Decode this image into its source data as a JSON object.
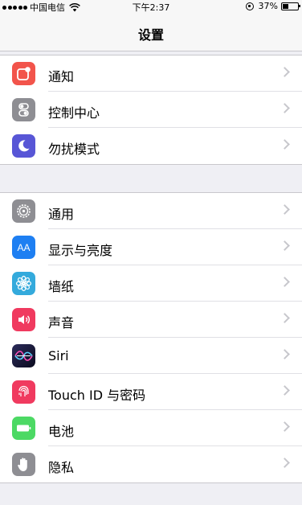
{
  "status_bar": {
    "carrier": "中国电信",
    "time": "下午2:37",
    "battery": "37%",
    "battery_level": 0.37
  },
  "nav": {
    "title": "设置"
  },
  "groups": [
    {
      "items": [
        {
          "label": "通知",
          "icon": "notifications-icon",
          "color": "#f2544b"
        },
        {
          "label": "控制中心",
          "icon": "control-center-icon",
          "color": "#8e8e93"
        },
        {
          "label": "勿扰模式",
          "icon": "moon-icon",
          "color": "#5856d6"
        }
      ]
    },
    {
      "items": [
        {
          "label": "通用",
          "icon": "gear-icon",
          "color": "#8e8e93"
        },
        {
          "label": "显示与亮度",
          "icon": "display-brightness-icon",
          "color": "#1e7ff2",
          "glyph": "AA"
        },
        {
          "label": "墙纸",
          "icon": "wallpaper-flower-icon",
          "color": "#34aadc"
        },
        {
          "label": "声音",
          "icon": "speaker-icon",
          "color": "#f03a5f"
        },
        {
          "label": "Siri",
          "icon": "siri-icon",
          "color": "#1c1c3a"
        },
        {
          "label": "Touch ID 与密码",
          "icon": "fingerprint-icon",
          "color": "#f03a5f"
        },
        {
          "label": "电池",
          "icon": "battery-icon",
          "color": "#4cd964"
        },
        {
          "label": "隐私",
          "icon": "hand-icon",
          "color": "#8e8e93"
        }
      ]
    }
  ]
}
